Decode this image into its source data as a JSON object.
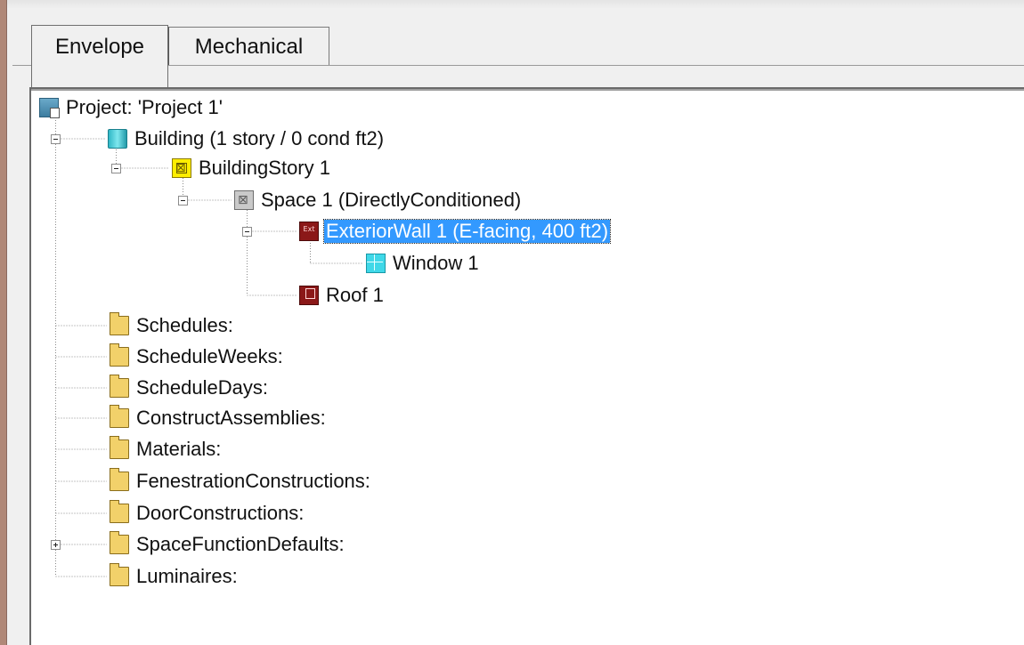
{
  "tabs": [
    {
      "label": "Envelope",
      "active": true
    },
    {
      "label": "Mechanical",
      "active": false
    }
  ],
  "tree": {
    "project": {
      "label": "Project:  'Project 1'",
      "icon": "project-icon"
    },
    "building": {
      "label": "Building  (1 story / 0 cond ft2)",
      "icon": "building-icon",
      "expanded": true
    },
    "story": {
      "label": "BuildingStory 1",
      "icon": "building-story-icon",
      "expanded": true
    },
    "space": {
      "label": "Space 1  (DirectlyConditioned)",
      "icon": "space-icon",
      "expanded": true
    },
    "exterior_wall": {
      "label": "ExteriorWall 1  (E-facing, 400 ft2)",
      "icon": "exterior-wall-icon",
      "icon_text": "Ext",
      "expanded": true,
      "selected": true
    },
    "window": {
      "label": "Window 1",
      "icon": "window-icon"
    },
    "roof": {
      "label": "Roof 1",
      "icon": "roof-icon"
    },
    "folders": [
      {
        "label": "Schedules:",
        "expandable": false
      },
      {
        "label": "ScheduleWeeks:",
        "expandable": false
      },
      {
        "label": "ScheduleDays:",
        "expandable": false
      },
      {
        "label": "ConstructAssemblies:",
        "expandable": false
      },
      {
        "label": "Materials:",
        "expandable": false
      },
      {
        "label": "FenestrationConstructions:",
        "expandable": false
      },
      {
        "label": "DoorConstructions:",
        "expandable": false
      },
      {
        "label": "SpaceFunctionDefaults:",
        "expandable": true
      },
      {
        "label": "Luminaires:",
        "expandable": false
      }
    ]
  },
  "colors": {
    "selection": "#3399ff",
    "panel_bg": "#ffffff",
    "window_bg": "#f0f0f0"
  }
}
